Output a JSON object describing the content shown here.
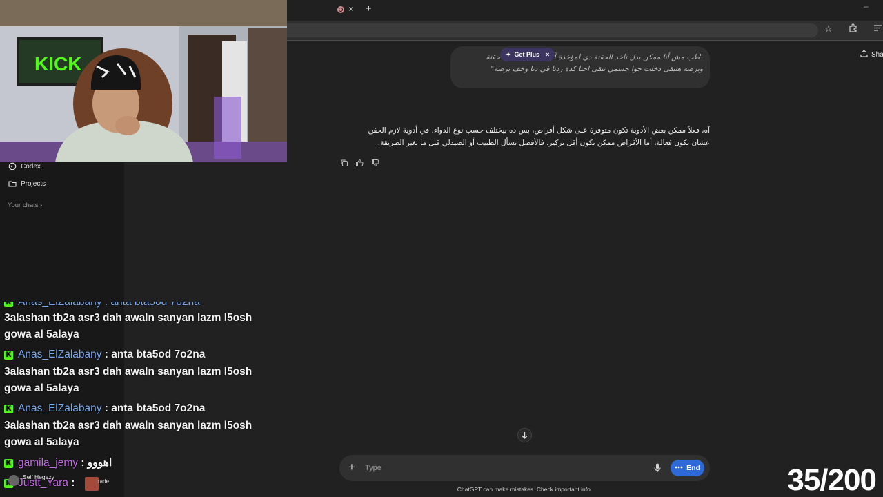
{
  "browser": {
    "tab_close": "×",
    "tab_new": "+",
    "window_min": "–"
  },
  "sidebar": {
    "items": [
      {
        "label": "Codex",
        "icon": "codex-icon"
      },
      {
        "label": "Projects",
        "icon": "folder-icon"
      }
    ],
    "your_chats": "Your chats ›"
  },
  "header": {
    "get_plus": "Get Plus",
    "get_plus_close": "×",
    "share": "Sha"
  },
  "conversation": {
    "user_message": "\"طب مش أنا ممكن بدل ناخد الحقنة دي لمؤخذة آخد حاجة أشرب الحقنة وبرضه هتبقى دخلت جوا جسمي نبقى احنا كدة زدنا في دنا وخف برضه\"",
    "assistant_message": "آه، فعلاً ممكن بعض الأدوية تكون متوفرة على شكل أقراص، بس ده بيختلف حسب نوع الدواء. في أدوية لازم الحقن عشان تكون فعالة، أما الأقراص ممكن تكون أقل تركيز. فالأفضل تسأل الطبيب أو الصيدلي قبل ما تغير الطريقة."
  },
  "composer": {
    "placeholder": "Type",
    "end_label": "End",
    "disclaimer": "ChatGPT can make mistakes. Check important info."
  },
  "stream_chat": {
    "partial_top": "Anas_ElZalabany : anta bta5od 7o2na",
    "messages": [
      {
        "user": "Anas_ElZalabany",
        "text": " : anta bta5od 7o2na",
        "cont1": "3alashan tb2a asr3 dah awaln sanyan lazm l5osh",
        "cont2": "gowa al 5alaya"
      },
      {
        "user": "Anas_ElZalabany",
        "text": " : anta bta5od 7o2na",
        "cont1": "3alashan tb2a asr3 dah awaln sanyan lazm l5osh",
        "cont2": "gowa al 5alaya"
      }
    ],
    "first_cont1": "3alashan tb2a asr3 dah awaln sanyan lazm l5osh",
    "first_cont2": "gowa al 5alaya",
    "gamila_user": "gamila_jemy",
    "gamila_text": " : اهووو",
    "yara_user": "Justt_Yara",
    "yara_text": " :",
    "overlay_name": "Seif Hegazy",
    "overlay_badge": "rade"
  },
  "counter": "35/200",
  "colors": {
    "background": "#212121",
    "sidebar": "#181818",
    "accent": "#2d6ad8",
    "kick_green": "#53fc18",
    "username_blue": "#7aa8ef",
    "username_purple": "#c46be6"
  }
}
